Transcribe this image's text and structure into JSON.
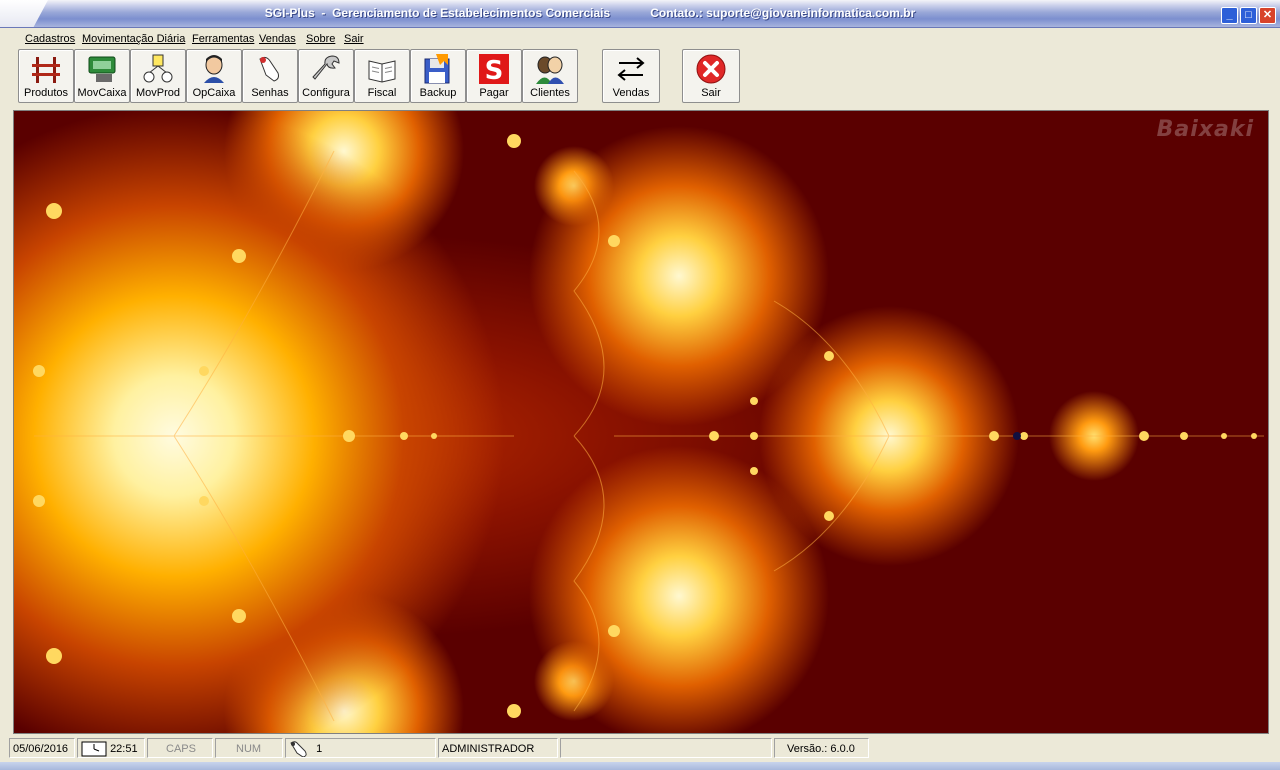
{
  "window": {
    "title": "SGI-Plus  -  Gerenciamento de Estabelecimentos Comerciais            Contato.: suporte@giovaneinformatica.com.br"
  },
  "menu": [
    "Cadastros",
    "Movimentação Diária",
    "Ferramentas",
    "Vendas",
    "Sobre",
    "Sair"
  ],
  "toolbar": {
    "buttons": [
      {
        "label": "Produtos",
        "icon": "shelves-icon"
      },
      {
        "label": "MovCaixa",
        "icon": "cash-register-icon"
      },
      {
        "label": "MovProd",
        "icon": "product-flow-icon"
      },
      {
        "label": "OpCaixa",
        "icon": "operator-icon"
      },
      {
        "label": "Senhas",
        "icon": "password-hand-icon"
      },
      {
        "label": "Configura",
        "icon": "wrench-icon"
      },
      {
        "label": "Fiscal",
        "icon": "book-icon"
      },
      {
        "label": "Backup",
        "icon": "floppy-disk-icon"
      },
      {
        "label": "Pagar",
        "icon": "pay-s-icon"
      },
      {
        "label": "Clientes",
        "icon": "clients-icon"
      },
      {
        "label": "Vendas",
        "icon": "swap-arrows-icon"
      },
      {
        "label": "Sair",
        "icon": "exit-x-icon"
      }
    ]
  },
  "canvas": {
    "watermark": "Baixaki"
  },
  "status": {
    "date": "05/06/2016",
    "time": "22:51",
    "caps": "CAPS",
    "num": "NUM",
    "user_count": "1",
    "user": "ADMINISTRADOR",
    "empty": "",
    "version": "Versão.:  6.0.0"
  },
  "colors": {
    "title_gradient": "#7c8fcf",
    "close": "#d8432a",
    "minmax": "#2d5fd8",
    "fractal_dark": "#5a0000",
    "fractal_bright": "#fff1a0"
  }
}
